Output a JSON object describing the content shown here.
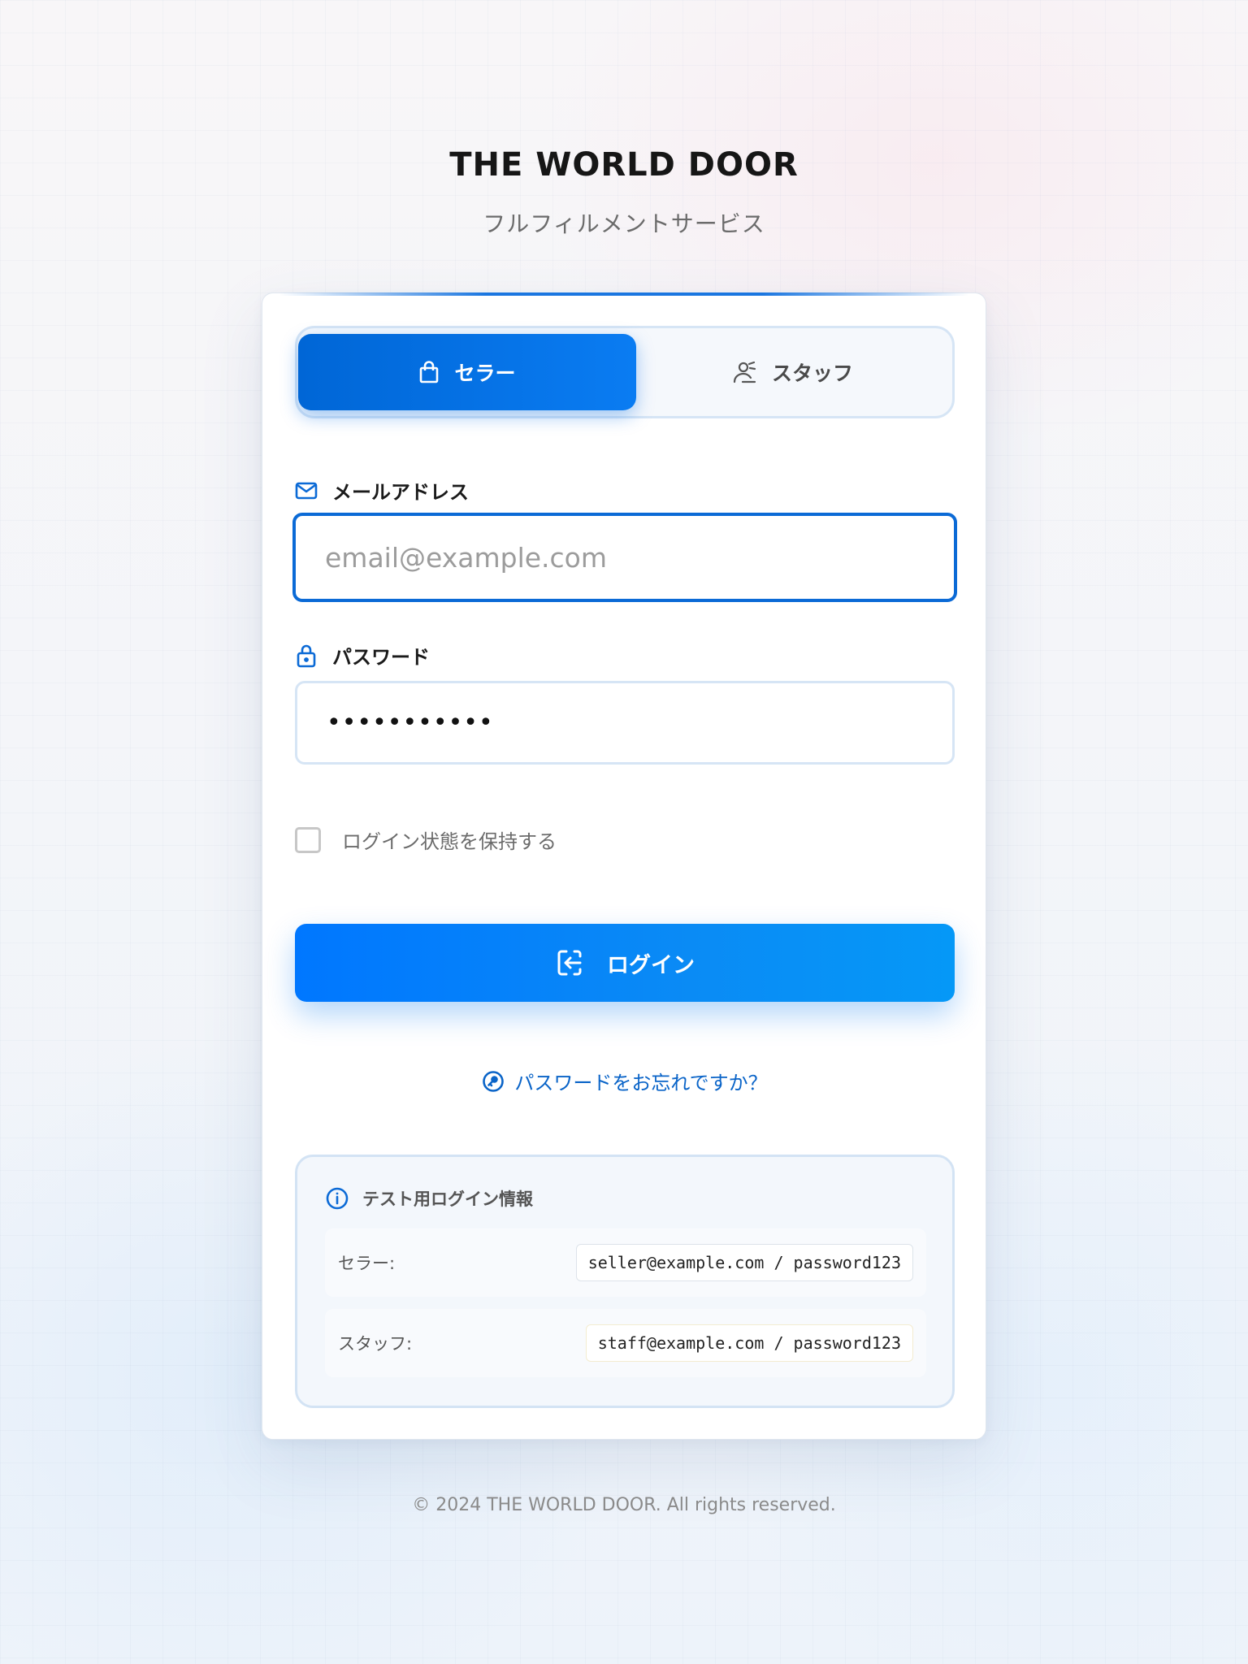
{
  "brand": {
    "title": "THE WORLD DOOR",
    "subtitle": "フルフィルメントサービス"
  },
  "tabs": [
    {
      "label": "セラー",
      "icon": "shopping-bag-icon",
      "active": true
    },
    {
      "label": "スタッフ",
      "icon": "staff-icon",
      "active": false
    }
  ],
  "email": {
    "label": "メールアドレス",
    "icon": "mail-icon",
    "placeholder": "email@example.com",
    "value": ""
  },
  "password": {
    "label": "パスワード",
    "icon": "lock-icon",
    "value": "•••••••••••"
  },
  "remember": {
    "label": "ログイン状態を保持する",
    "checked": false
  },
  "login_button": {
    "label": "ログイン",
    "icon": "login-icon"
  },
  "forgot": {
    "label": "パスワードをお忘れですか？",
    "icon": "key-icon"
  },
  "test_info": {
    "title": "テスト用ログイン情報",
    "icon": "info-icon",
    "rows": [
      {
        "label": "セラー:",
        "value": "seller@example.com / password123"
      },
      {
        "label": "スタッフ:",
        "value": "staff@example.com / password123"
      }
    ]
  },
  "footer": "© 2024 THE WORLD DOOR. All rights reserved.",
  "colors": {
    "accent": "#0b6ad6",
    "button_gradient_start": "#0077ff",
    "button_gradient_end": "#0598f7",
    "link": "#0a64c8"
  }
}
